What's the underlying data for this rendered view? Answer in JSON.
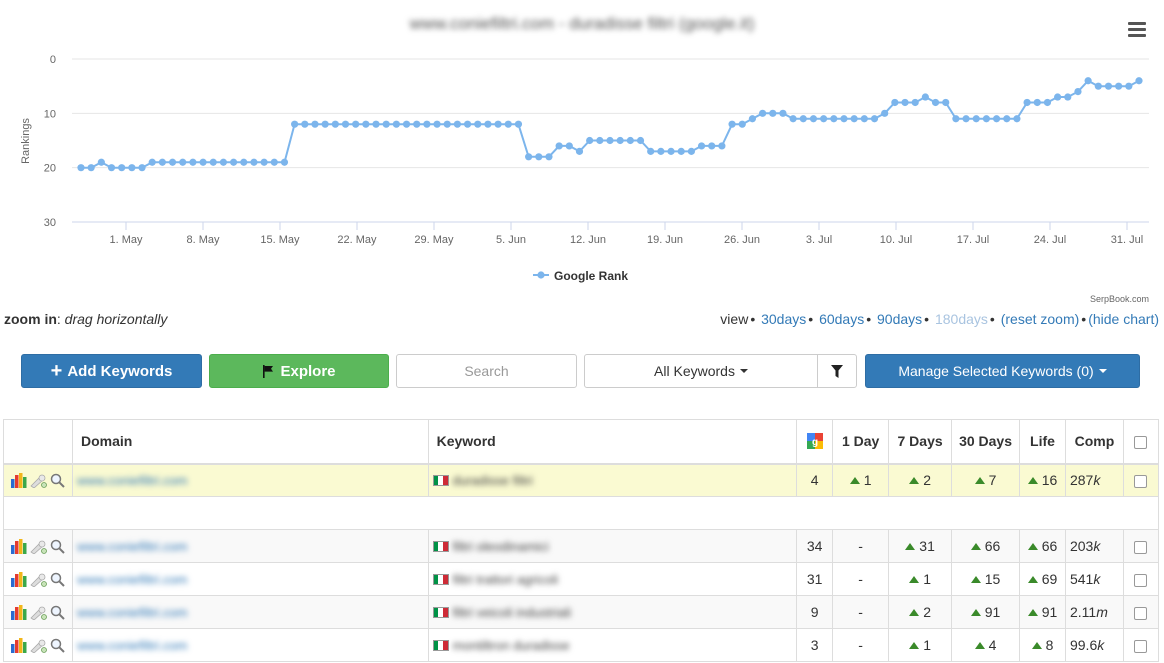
{
  "chart": {
    "title": "www.coniefiltri.com - duradisse filtri (google.it)",
    "credit": "SerpBook.com",
    "menu_icon": "hamburger-menu-icon"
  },
  "chart_data": {
    "type": "line",
    "title": "www.coniefiltri.com - duradisse filtri (google.it)",
    "ylabel": "Rankings",
    "ylim": [
      0,
      30
    ],
    "y_inverted": true,
    "yticks": [
      "0",
      "10",
      "20",
      "30"
    ],
    "x_start": "2024-04-25",
    "xticks": [
      "1. May",
      "8. May",
      "15. May",
      "22. May",
      "29. May",
      "5. Jun",
      "12. Jun",
      "19. Jun",
      "26. Jun",
      "3. Jul",
      "10. Jul",
      "17. Jul",
      "24. Jul",
      "31. Jul"
    ],
    "series": [
      {
        "name": "Google Rank",
        "color": "#7cb5ec",
        "values": [
          20,
          20,
          19,
          20,
          20,
          20,
          20,
          19,
          19,
          19,
          19,
          19,
          19,
          19,
          19,
          19,
          19,
          19,
          19,
          19,
          19,
          12,
          12,
          12,
          12,
          12,
          12,
          12,
          12,
          12,
          12,
          12,
          12,
          12,
          12,
          12,
          12,
          12,
          12,
          12,
          12,
          12,
          12,
          12,
          18,
          18,
          18,
          16,
          16,
          17,
          15,
          15,
          15,
          15,
          15,
          15,
          17,
          17,
          17,
          17,
          17,
          16,
          16,
          16,
          12,
          12,
          11,
          10,
          10,
          10,
          11,
          11,
          11,
          11,
          11,
          11,
          11,
          11,
          11,
          10,
          8,
          8,
          8,
          7,
          8,
          8,
          11,
          11,
          11,
          11,
          11,
          11,
          11,
          8,
          8,
          8,
          7,
          7,
          6,
          4,
          5,
          5,
          5,
          5,
          4
        ]
      }
    ],
    "legend": "bottom-center",
    "grid": true
  },
  "zoom": {
    "label": "zoom in",
    "hint": "drag horizontally"
  },
  "view": {
    "label": "view",
    "opt1": "30days",
    "opt2": "60days",
    "opt3": "90days",
    "opt4": "180days",
    "reset": "(reset zoom)",
    "hide": "(hide chart)"
  },
  "toolbar": {
    "add_label": "Add Keywords",
    "explore_label": "Explore",
    "search_placeholder": "Search",
    "filter_label": "All Keywords",
    "manage_label": "Manage Selected Keywords (0)"
  },
  "table": {
    "headers": {
      "domain": "Domain",
      "keyword": "Keyword",
      "day1": "1 Day",
      "day7": "7 Days",
      "day30": "30 Days",
      "life": "Life",
      "comp": "Comp"
    },
    "rows": [
      {
        "domain": "www.coniefiltri.com",
        "keyword": "duradisse filtri",
        "rank": "4",
        "day1": "1",
        "day7": "2",
        "day30": "7",
        "life": "16",
        "comp_num": "287",
        "comp_unit": "k"
      },
      {
        "domain": "www.coniefiltri.com",
        "keyword": "filtri oleodinamici",
        "rank": "34",
        "day1": "-",
        "day7": "31",
        "day30": "66",
        "life": "66",
        "comp_num": "203",
        "comp_unit": "k"
      },
      {
        "domain": "www.coniefiltri.com",
        "keyword": "filtri trattori agricoli",
        "rank": "31",
        "day1": "-",
        "day7": "1",
        "day30": "15",
        "life": "69",
        "comp_num": "541",
        "comp_unit": "k"
      },
      {
        "domain": "www.coniefiltri.com",
        "keyword": "filtri veicoli industriali",
        "rank": "9",
        "day1": "-",
        "day7": "2",
        "day30": "91",
        "life": "91",
        "comp_num": "2.11",
        "comp_unit": "m"
      },
      {
        "domain": "www.coniefiltri.com",
        "keyword": "montiltron duradisse",
        "rank": "3",
        "day1": "-",
        "day7": "1",
        "day30": "4",
        "life": "8",
        "comp_num": "99.6",
        "comp_unit": "k"
      }
    ]
  },
  "colors": {
    "primary": "#337ab7",
    "success": "#5cb85c",
    "highlight_row": "#fafad2",
    "up_arrow": "#3a8a2a"
  }
}
